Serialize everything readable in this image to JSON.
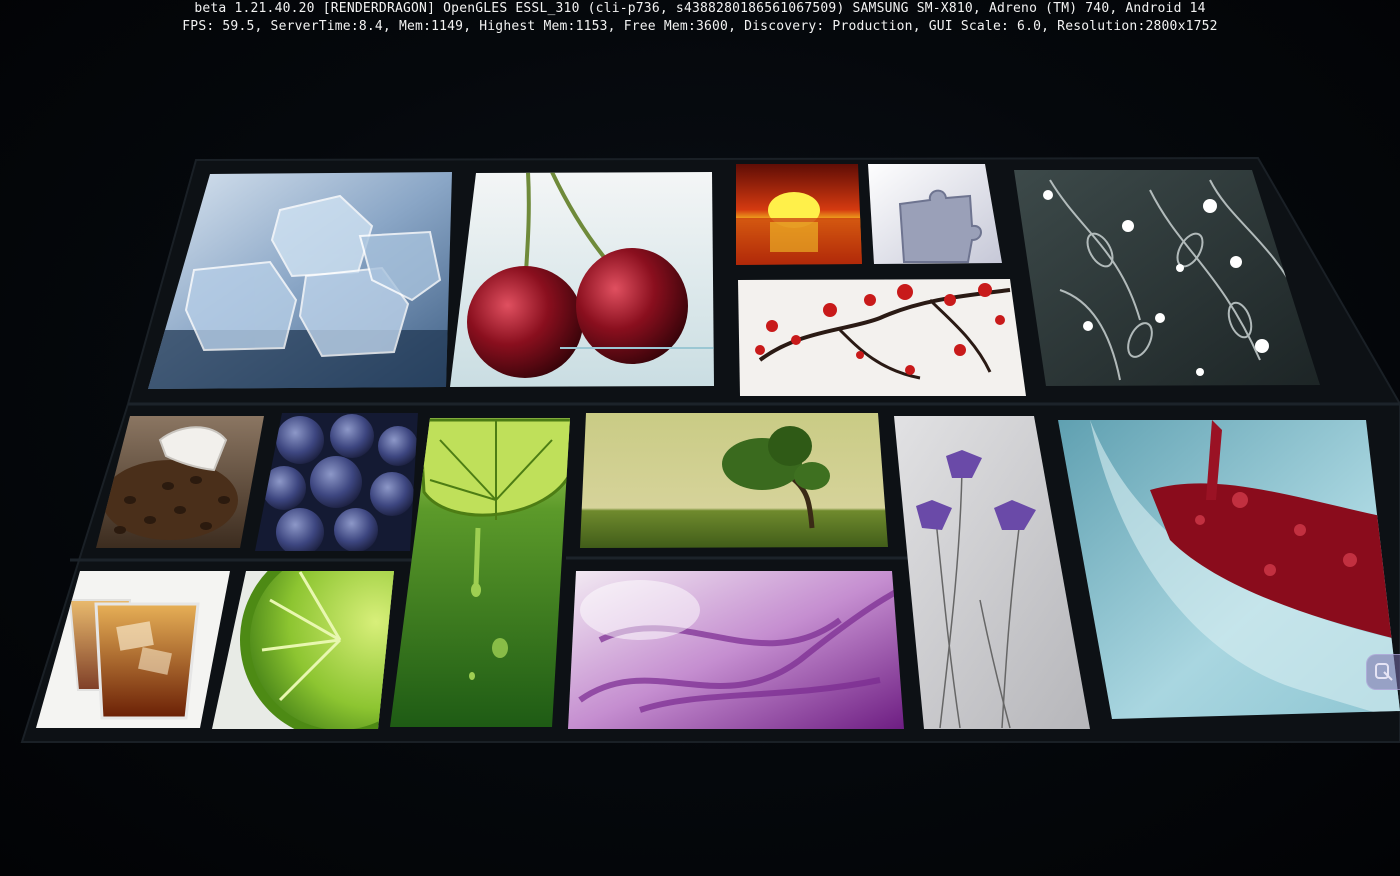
{
  "debug_overlay": {
    "line1": "beta 1.21.40.20 [RENDERDRAGON] OpenGLES ESSL_310 (cli-p736, s4388280186561067509) SAMSUNG SM-X810, Adreno (TM) 740, Android 14",
    "line2": "FPS: 59.5, ServerTime:8.4, Mem:1149, Highest Mem:1153, Free Mem:3600, Discovery: Production, GUI Scale: 6.0, Resolution:2800x1752"
  },
  "paintings": [
    {
      "id": "ice-cubes",
      "subject": "Ice cubes"
    },
    {
      "id": "cherries",
      "subject": "Cherries"
    },
    {
      "id": "sunset",
      "subject": "Sunset over sea"
    },
    {
      "id": "puzzle",
      "subject": "Puzzle piece"
    },
    {
      "id": "floral-pattern",
      "subject": "Floral pattern"
    },
    {
      "id": "blossom-branch",
      "subject": "Blossom branch"
    },
    {
      "id": "coffee-beans",
      "subject": "Coffee beans"
    },
    {
      "id": "blueberries",
      "subject": "Blueberries"
    },
    {
      "id": "lime-drip",
      "subject": "Lime slice dripping"
    },
    {
      "id": "windswept-tree",
      "subject": "Windswept tree"
    },
    {
      "id": "purple-flowers",
      "subject": "Purple flowers"
    },
    {
      "id": "red-wine",
      "subject": "Red wine glass"
    },
    {
      "id": "whiskey-glasses",
      "subject": "Whiskey glasses"
    },
    {
      "id": "lime-slice",
      "subject": "Lime slice"
    },
    {
      "id": "purple-smoke",
      "subject": "Purple smoke"
    }
  ],
  "colors": {
    "background": "#05080c",
    "frame": "#0d1115",
    "text": "#f2f2f2"
  }
}
